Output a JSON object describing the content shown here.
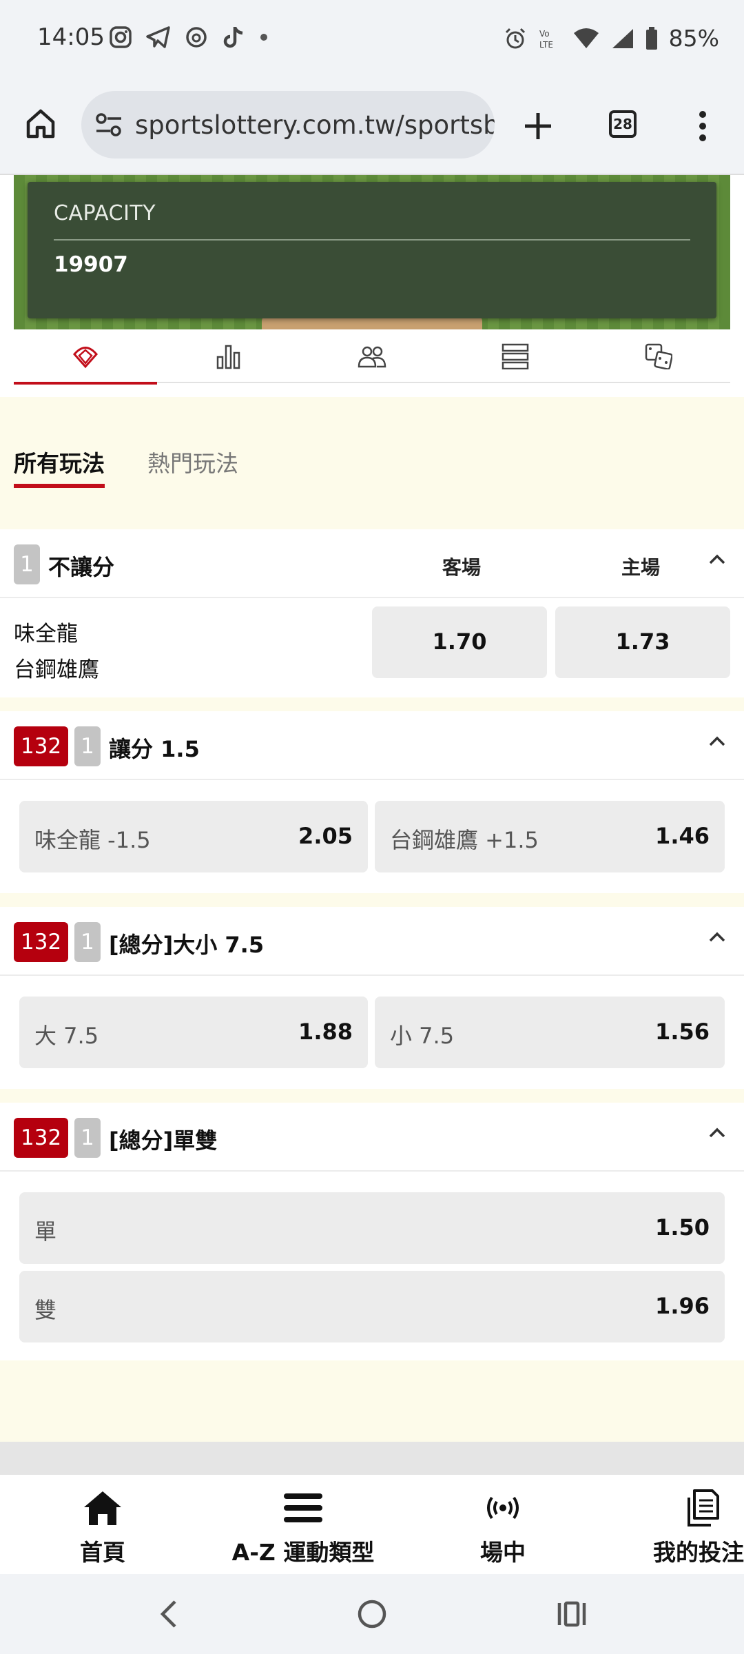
{
  "status_bar": {
    "time": "14:05",
    "battery": "85%",
    "network": "LTE"
  },
  "browser": {
    "url": "sportslottery.com.tw/sportsb",
    "tab_count": "28"
  },
  "venue": {
    "capacity_label": "CAPACITY",
    "capacity_value": "19907"
  },
  "icon_tabs": [
    {
      "name": "baseball-diamond-icon",
      "active": true
    },
    {
      "name": "bar-chart-icon",
      "active": false
    },
    {
      "name": "players-icon",
      "active": false
    },
    {
      "name": "list-icon",
      "active": false
    },
    {
      "name": "dice-icon",
      "active": false
    }
  ],
  "market_tabs": {
    "all": "所有玩法",
    "popular": "熱門玩法"
  },
  "markets": {
    "moneyline": {
      "grey_badge": "1",
      "title": "不讓分",
      "away_label": "客場",
      "home_label": "主場",
      "team_away": "味全龍",
      "team_home": "台鋼雄鷹",
      "away_odds": "1.70",
      "home_odds": "1.73"
    },
    "handicap": {
      "red_badge": "132",
      "grey_badge": "1",
      "title": "讓分 1.5",
      "left_label": "味全龍 -1.5",
      "left_odds": "2.05",
      "right_label": "台鋼雄鷹 +1.5",
      "right_odds": "1.46"
    },
    "total": {
      "red_badge": "132",
      "grey_badge": "1",
      "title": "[總分]大小 7.5",
      "left_label": "大 7.5",
      "left_odds": "1.88",
      "right_label": "小 7.5",
      "right_odds": "1.56"
    },
    "odd_even": {
      "red_badge": "132",
      "grey_badge": "1",
      "title": "[總分]單雙",
      "odd_label": "單",
      "odd_odds": "1.50",
      "even_label": "雙",
      "even_odds": "1.96"
    }
  },
  "bottom_nav": {
    "home": "首頁",
    "az": "A-Z 運動類型",
    "live": "場中",
    "my_bets": "我的投注"
  },
  "colors": {
    "accent_red": "#c20e1a",
    "badge_red": "#b5000e",
    "cream_bg": "#fdfbea",
    "odds_button": "#ececec"
  }
}
